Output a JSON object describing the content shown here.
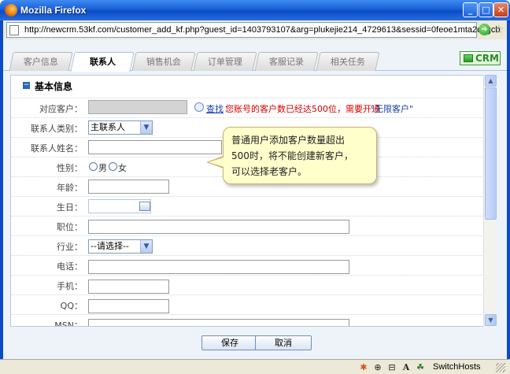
{
  "window": {
    "title": "Mozilla Firefox",
    "minimize": "_",
    "maximize": "□",
    "close": "✕"
  },
  "url_bar": {
    "url": "http://newcrm.53kf.com/customer_add_kf.php?guest_id=1403793107&arg=plukejie214_4729613&sessid=0feoe1mta2c2gcb"
  },
  "tabs": [
    {
      "label": "客户信息",
      "active": false
    },
    {
      "label": "联系人",
      "active": true
    },
    {
      "label": "销售机会",
      "active": false
    },
    {
      "label": "订单管理",
      "active": false
    },
    {
      "label": "客服记录",
      "active": false
    },
    {
      "label": "相关任务",
      "active": false
    }
  ],
  "crm_button": {
    "label": "CRM"
  },
  "section": {
    "collapse_glyph": "−",
    "title": "基本信息"
  },
  "form": {
    "customer": {
      "label": "对应客户：",
      "search_link": "查找",
      "warning": "您账号的客户数已经达500位，需要开通",
      "warning_link": "\"无限客户\""
    },
    "contact_type": {
      "label": "联系人类别：",
      "value": "主联系人"
    },
    "contact_name": {
      "label": "联系人姓名："
    },
    "gender": {
      "label": "性别：",
      "male": "男",
      "female": "女"
    },
    "age": {
      "label": "年龄："
    },
    "birthday": {
      "label": "生日："
    },
    "position": {
      "label": "职位："
    },
    "industry": {
      "label": "行业：",
      "value": "--请选择--"
    },
    "phone": {
      "label": "电话："
    },
    "mobile": {
      "label": "手机："
    },
    "qq": {
      "label": "QQ："
    },
    "msn": {
      "label": "MSN："
    }
  },
  "tooltip": {
    "line1": "普通用户添加客户数量超出",
    "line2": "500时，将不能创建新客户，",
    "line3": "可以选择老客户。"
  },
  "buttons": {
    "save": "保存",
    "cancel": "取消"
  },
  "status_bar": {
    "switchhosts": "SwitchHosts",
    "font_glyph": "A"
  },
  "colors": {
    "titlebar": "#0a4bc6",
    "active_tab": "#ffffff",
    "warning_text": "#d40000",
    "tooltip_bg": "#ffffcc",
    "crm_green": "#2a8a2a"
  }
}
